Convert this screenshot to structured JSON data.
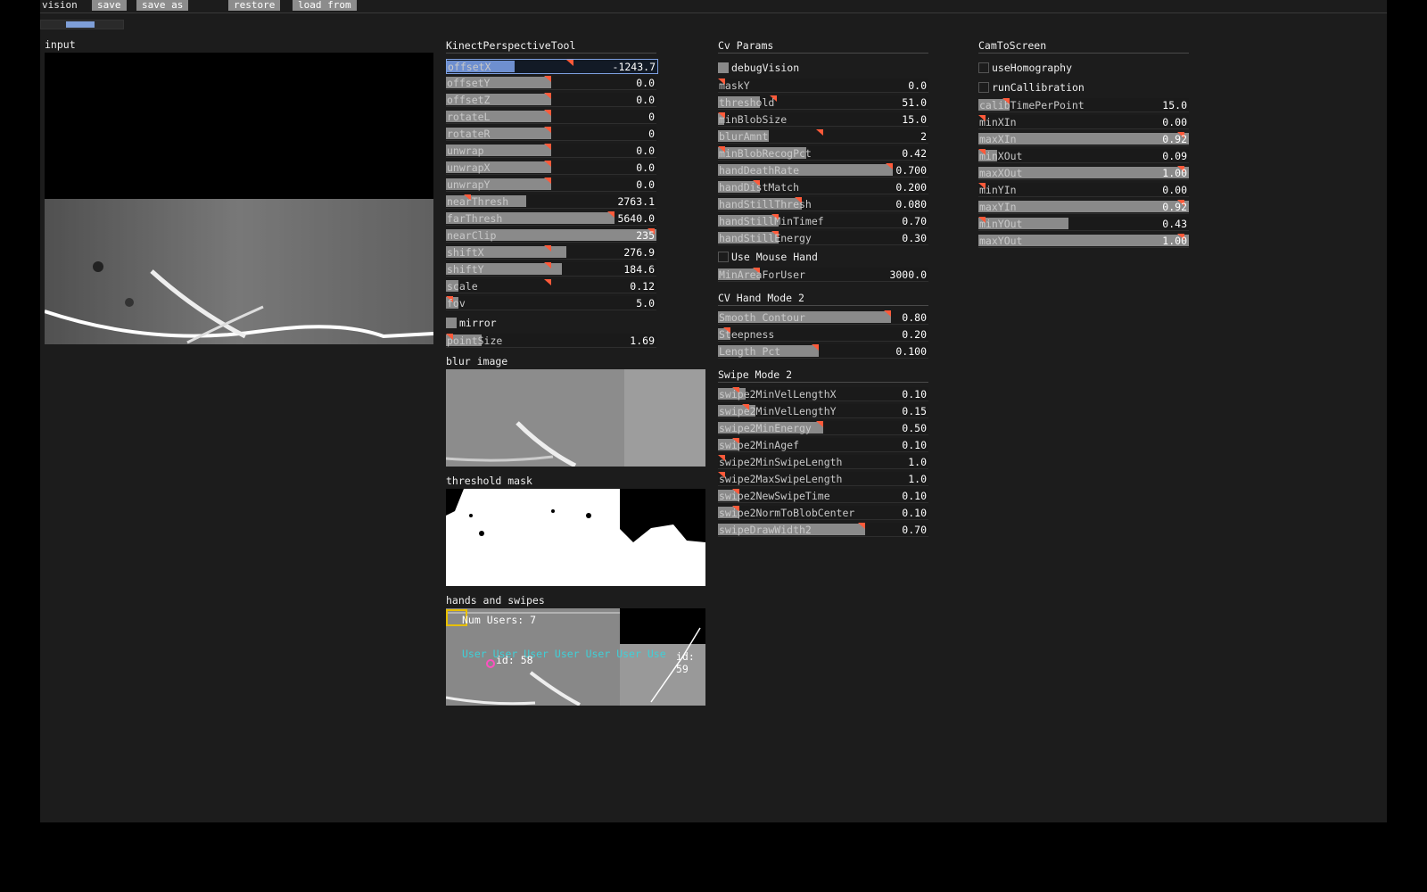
{
  "topbar": {
    "title": "vision",
    "save": "save",
    "save_as": "save as",
    "restore": "restore",
    "load_from": "load from"
  },
  "labels": {
    "input": "input",
    "blur": "blur image",
    "threshold": "threshold mask",
    "hands": "hands and swipes"
  },
  "overlay": {
    "num_users": "Num Users: 7",
    "user_tags": [
      "User",
      "User",
      "User",
      "User",
      "User",
      "User",
      "Use"
    ],
    "id_a": "id: 58",
    "id_b": "id: 59"
  },
  "colors": {
    "accent": "#7ea0e0",
    "marker": "#ff5a3a",
    "bar": "#8a8a8a",
    "panel": "#1c1c1c"
  },
  "panels": {
    "kinect": {
      "title": "KinectPerspectiveTool",
      "sliders": [
        {
          "name": "offsetX",
          "value": "-1243.7",
          "fill": 0.32,
          "marker": 0.6,
          "selected": true
        },
        {
          "name": "offsetY",
          "value": "0.0",
          "fill": 0.5,
          "marker": 0.5
        },
        {
          "name": "offsetZ",
          "value": "0.0",
          "fill": 0.5,
          "marker": 0.5
        },
        {
          "name": "rotateL",
          "value": "0",
          "fill": 0.5,
          "marker": 0.5
        },
        {
          "name": "rotateR",
          "value": "0",
          "fill": 0.5,
          "marker": 0.5
        },
        {
          "name": "unwrap",
          "value": "0.0",
          "fill": 0.5,
          "marker": 0.5
        },
        {
          "name": "unwrapX",
          "value": "0.0",
          "fill": 0.5,
          "marker": 0.5
        },
        {
          "name": "unwrapY",
          "value": "0.0",
          "fill": 0.5,
          "marker": 0.5
        },
        {
          "name": "nearThresh",
          "value": "2763.1",
          "fill": 0.38,
          "marker": 0.12
        },
        {
          "name": "farThresh",
          "value": "5640.0",
          "fill": 0.8,
          "marker": 0.8
        },
        {
          "name": "nearClip",
          "value": "235",
          "fill": 1.0,
          "marker": 0.99
        },
        {
          "name": "shiftX",
          "value": "276.9",
          "fill": 0.57,
          "marker": 0.5
        },
        {
          "name": "shiftY",
          "value": "184.6",
          "fill": 0.55,
          "marker": 0.5
        },
        {
          "name": "scale",
          "value": "0.12",
          "fill": 0.06,
          "marker": 0.5
        },
        {
          "name": "fov",
          "value": "5.0",
          "fill": 0.06,
          "marker": 0.02
        }
      ],
      "mirror": {
        "label": "mirror",
        "checked": true
      },
      "pointSize": {
        "name": "pointSize",
        "value": "1.69",
        "fill": 0.17,
        "marker": 0.0
      }
    },
    "cv": {
      "title": "Cv Params",
      "debugVision": {
        "label": "debugVision",
        "checked": true
      },
      "sliders": [
        {
          "name": "maskY",
          "value": "0.0",
          "fill": 0.0,
          "marker": 0.0
        },
        {
          "name": "threshold",
          "value": "51.0",
          "fill": 0.2,
          "marker": 0.28
        },
        {
          "name": "minBlobSize",
          "value": "15.0",
          "fill": 0.03,
          "marker": 0.0
        },
        {
          "name": "blurAmnt",
          "value": "2",
          "fill": 0.24,
          "marker": 0.5
        },
        {
          "name": "minBlobRecogPct",
          "value": "0.42",
          "fill": 0.42,
          "marker": 0.0
        },
        {
          "name": "handDeathRate",
          "value": "0.700",
          "fill": 0.83,
          "marker": 0.83
        },
        {
          "name": "handDistMatch",
          "value": "0.200",
          "fill": 0.2,
          "marker": 0.2
        },
        {
          "name": "handStillThresh",
          "value": "0.080",
          "fill": 0.4,
          "marker": 0.4
        },
        {
          "name": "handStillMinTimef",
          "value": "0.70",
          "fill": 0.29,
          "marker": 0.29
        },
        {
          "name": "handStillEnergy",
          "value": "0.30",
          "fill": 0.29,
          "marker": 0.29
        }
      ],
      "useMouseHand": {
        "label": "Use Mouse Hand",
        "checked": false
      },
      "minArea": {
        "name": "MinAreaForUser",
        "value": "3000.0",
        "fill": 0.2,
        "marker": 0.2
      }
    },
    "hand": {
      "title": "CV Hand Mode 2",
      "sliders": [
        {
          "name": "Smooth Contour",
          "value": "0.80",
          "fill": 0.82,
          "marker": 0.82
        },
        {
          "name": "Steepness",
          "value": "0.20",
          "fill": 0.06,
          "marker": 0.06
        },
        {
          "name": "Length Pct",
          "value": "0.100",
          "fill": 0.48,
          "marker": 0.48
        }
      ]
    },
    "swipe": {
      "title": "Swipe Mode 2",
      "sliders": [
        {
          "name": "swipe2MinVelLengthX",
          "value": "0.10",
          "fill": 0.13,
          "marker": 0.1
        },
        {
          "name": "swipe2MinVelLengthY",
          "value": "0.15",
          "fill": 0.18,
          "marker": 0.15
        },
        {
          "name": "swipe2MinEnergy",
          "value": "0.50",
          "fill": 0.5,
          "marker": 0.5
        },
        {
          "name": "swipe2MinAgef",
          "value": "0.10",
          "fill": 0.1,
          "marker": 0.1
        },
        {
          "name": "swipe2MinSwipeLength",
          "value": "1.0",
          "fill": 0.0,
          "marker": 0.0
        },
        {
          "name": "swipe2MaxSwipeLength",
          "value": "1.0",
          "fill": 0.0,
          "marker": 0.0
        },
        {
          "name": "swipe2NewSwipeTime",
          "value": "0.10",
          "fill": 0.1,
          "marker": 0.1
        },
        {
          "name": "swipe2NormToBlobCenter",
          "value": "0.10",
          "fill": 0.1,
          "marker": 0.1
        },
        {
          "name": "swipeDrawWidth2",
          "value": "0.70",
          "fill": 0.7,
          "marker": 0.7
        }
      ]
    },
    "cam": {
      "title": "CamToScreen",
      "useHomography": {
        "label": "useHomography",
        "checked": false
      },
      "runCallibration": {
        "label": "runCallibration",
        "checked": false
      },
      "sliders": [
        {
          "name": "calibTimePerPoint",
          "value": "15.0",
          "fill": 0.15,
          "marker": 0.15
        },
        {
          "name": "minXIn",
          "value": "0.00",
          "fill": 0.0,
          "marker": 0.0
        },
        {
          "name": "maxXIn",
          "value": "0.92",
          "fill": 1.0,
          "marker": 0.98
        },
        {
          "name": "minXOut",
          "value": "0.09",
          "fill": 0.09,
          "marker": 0.02
        },
        {
          "name": "maxXOut",
          "value": "1.00",
          "fill": 1.0,
          "marker": 0.98
        },
        {
          "name": "minYIn",
          "value": "0.00",
          "fill": 0.0,
          "marker": 0.0
        },
        {
          "name": "maxYIn",
          "value": "0.92",
          "fill": 1.0,
          "marker": 0.98
        },
        {
          "name": "minYOut",
          "value": "0.43",
          "fill": 0.43,
          "marker": 0.02
        },
        {
          "name": "maxYOut",
          "value": "1.00",
          "fill": 1.0,
          "marker": 0.98
        }
      ]
    }
  }
}
